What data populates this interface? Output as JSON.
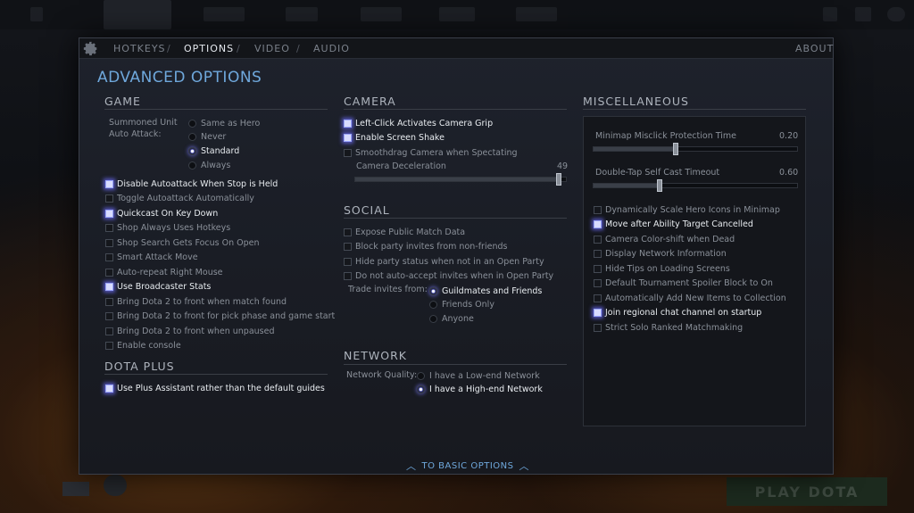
{
  "tabs": [
    {
      "label": "HOTKEYS",
      "active": false
    },
    {
      "label": "OPTIONS",
      "active": true
    },
    {
      "label": "VIDEO",
      "active": false
    },
    {
      "label": "AUDIO",
      "active": false
    }
  ],
  "about_label": "ABOUT",
  "title": "ADVANCED OPTIONS",
  "game": {
    "heading": "GAME",
    "summoned_label_1": "Summoned Unit",
    "summoned_label_2": "Auto Attack:",
    "summoned_options": [
      {
        "label": "Same as Hero",
        "selected": false
      },
      {
        "label": "Never",
        "selected": false
      },
      {
        "label": "Standard",
        "selected": true
      },
      {
        "label": "Always",
        "selected": false
      }
    ],
    "checkboxes": [
      {
        "label": "Disable Autoattack When Stop is Held",
        "checked": true
      },
      {
        "label": "Toggle Autoattack Automatically",
        "checked": false
      },
      {
        "label": "Quickcast On Key Down",
        "checked": true
      },
      {
        "label": "Shop Always Uses Hotkeys",
        "checked": false
      },
      {
        "label": "Shop Search Gets Focus On Open",
        "checked": false
      },
      {
        "label": "Smart Attack Move",
        "checked": false
      },
      {
        "label": "Auto-repeat Right Mouse",
        "checked": false
      },
      {
        "label": "Use Broadcaster Stats",
        "checked": true
      },
      {
        "label": "Bring Dota 2 to front when match found",
        "checked": false
      },
      {
        "label": "Bring Dota 2 to front for pick phase and game start",
        "checked": false
      },
      {
        "label": "Bring Dota 2 to front when unpaused",
        "checked": false
      },
      {
        "label": "Enable console",
        "checked": false
      }
    ]
  },
  "dota_plus": {
    "heading": "DOTA PLUS",
    "checkboxes": [
      {
        "label": "Use Plus Assistant rather than the default guides",
        "checked": true
      }
    ]
  },
  "camera": {
    "heading": "CAMERA",
    "checkboxes": [
      {
        "label": "Left-Click Activates Camera Grip",
        "checked": true
      },
      {
        "label": "Enable Screen Shake",
        "checked": true
      },
      {
        "label": "Smoothdrag Camera when Spectating",
        "checked": false
      }
    ],
    "deceleration_label": "Camera Deceleration",
    "deceleration_value": "49",
    "deceleration_fraction": 0.98
  },
  "social": {
    "heading": "SOCIAL",
    "checkboxes": [
      {
        "label": "Expose Public Match Data",
        "checked": false
      },
      {
        "label": "Block party invites from non-friends",
        "checked": false
      },
      {
        "label": "Hide party status when not in an Open Party",
        "checked": false
      },
      {
        "label": "Do not auto-accept invites when in Open Party",
        "checked": false
      }
    ],
    "trade_label": "Trade invites from:",
    "trade_options": [
      {
        "label": "Guildmates and Friends",
        "selected": true
      },
      {
        "label": "Friends Only",
        "selected": false
      },
      {
        "label": "Anyone",
        "selected": false
      }
    ]
  },
  "network": {
    "heading": "NETWORK",
    "quality_label": "Network Quality:",
    "options": [
      {
        "label": "I have a Low-end Network",
        "selected": false
      },
      {
        "label": "I have a High-end Network",
        "selected": true
      }
    ]
  },
  "misc": {
    "heading": "MISCELLANEOUS",
    "minimap_label": "Minimap Misclick Protection Time",
    "minimap_value": "0.20",
    "minimap_fraction": 0.4,
    "doubletap_label": "Double-Tap Self Cast Timeout",
    "doubletap_value": "0.60",
    "doubletap_fraction": 0.32,
    "checkboxes": [
      {
        "label": "Dynamically Scale Hero Icons in Minimap",
        "checked": false
      },
      {
        "label": "Move after Ability Target Cancelled",
        "checked": true
      },
      {
        "label": "Camera Color-shift when Dead",
        "checked": false
      },
      {
        "label": "Display Network Information",
        "checked": false
      },
      {
        "label": "Hide Tips on Loading Screens",
        "checked": false
      },
      {
        "label": "Default Tournament Spoiler Block to On",
        "checked": false
      },
      {
        "label": "Automatically Add New Items to Collection",
        "checked": false
      },
      {
        "label": "Join regional chat channel on startup",
        "checked": true
      },
      {
        "label": "Strict Solo Ranked Matchmaking",
        "checked": false
      }
    ]
  },
  "back_link": "TO BASIC OPTIONS",
  "play_button": "PLAY DOTA",
  "colors": {
    "accent": "#6fa8dc",
    "checked_glow": "#9aa4ff"
  }
}
